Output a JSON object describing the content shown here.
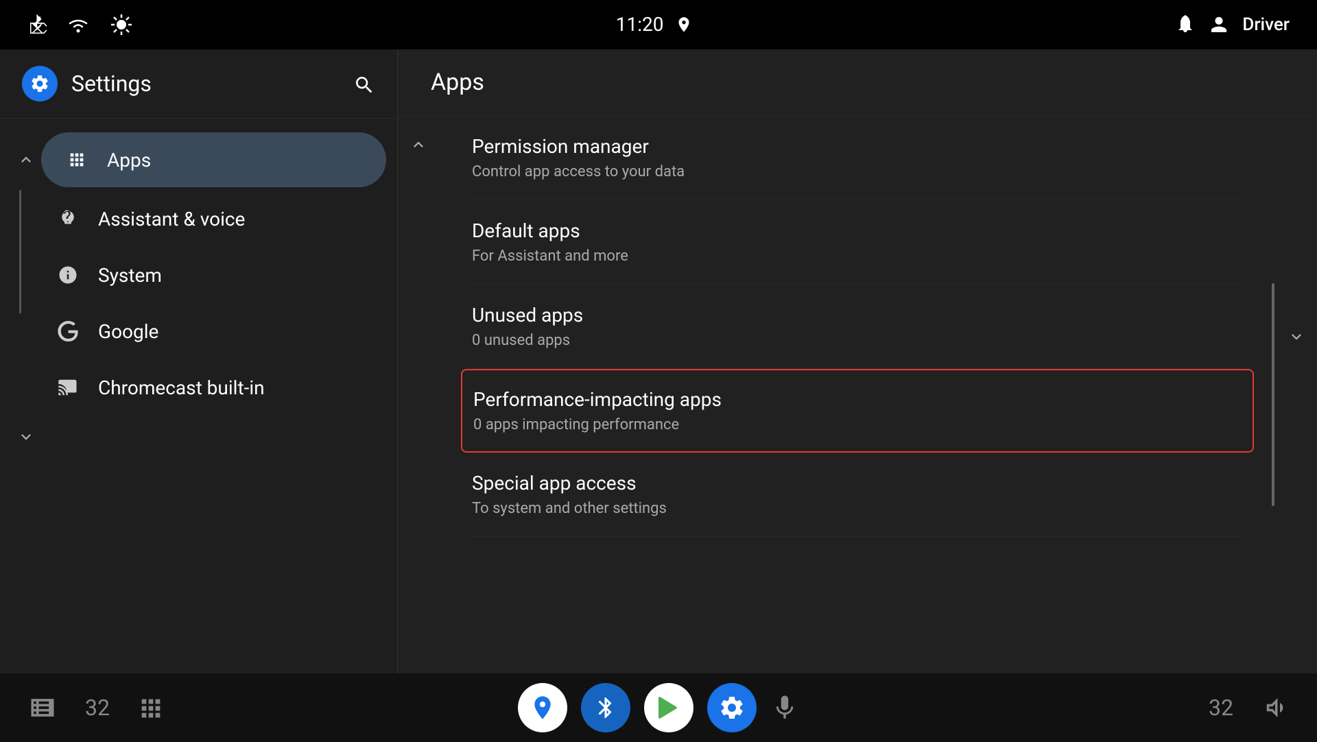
{
  "statusBar": {
    "time": "11:20",
    "user": "Driver"
  },
  "leftPanel": {
    "title": "Settings",
    "activeItem": "Apps",
    "items": [
      {
        "id": "apps",
        "label": "Apps",
        "icon": "grid"
      },
      {
        "id": "assistant",
        "label": "Assistant & voice",
        "icon": "assistant"
      },
      {
        "id": "system",
        "label": "System",
        "icon": "info"
      },
      {
        "id": "google",
        "label": "Google",
        "icon": "google"
      },
      {
        "id": "chromecast",
        "label": "Chromecast built-in",
        "icon": "cast"
      }
    ]
  },
  "rightPanel": {
    "title": "Apps",
    "items": [
      {
        "id": "permission-manager",
        "title": "Permission manager",
        "subtitle": "Control app access to your data",
        "selected": false
      },
      {
        "id": "default-apps",
        "title": "Default apps",
        "subtitle": "For Assistant and more",
        "selected": false
      },
      {
        "id": "unused-apps",
        "title": "Unused apps",
        "subtitle": "0 unused apps",
        "selected": false
      },
      {
        "id": "performance-impacting-apps",
        "title": "Performance-impacting apps",
        "subtitle": "0 apps impacting performance",
        "selected": true
      },
      {
        "id": "special-app-access",
        "title": "Special app access",
        "subtitle": "To system and other settings",
        "selected": false
      }
    ]
  },
  "taskbar": {
    "leftNum": "32",
    "rightNum": "32"
  }
}
